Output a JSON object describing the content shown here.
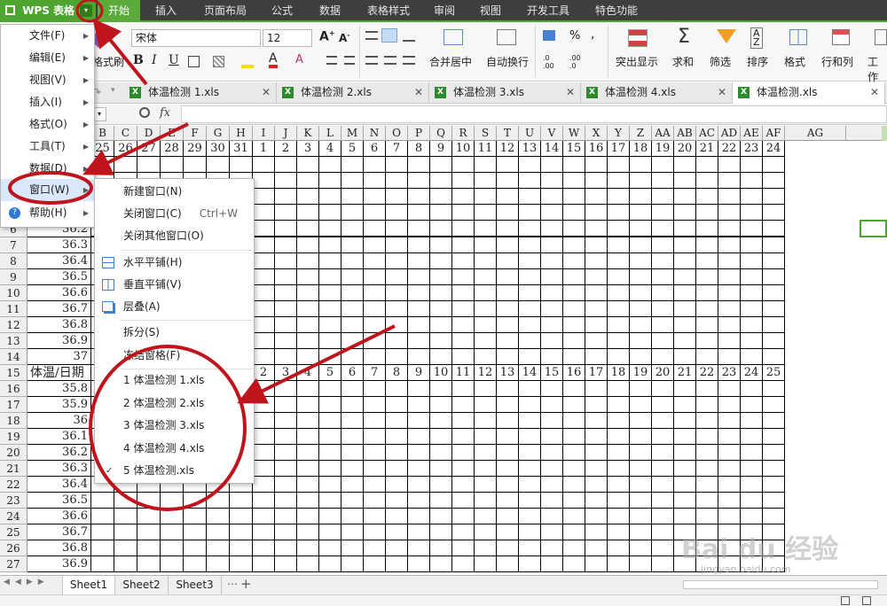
{
  "app": {
    "title": "WPS 表格",
    "dropdown_glyph": "▾"
  },
  "tabs": [
    "开始",
    "插入",
    "页面布局",
    "公式",
    "数据",
    "表格样式",
    "审阅",
    "视图",
    "开发工具",
    "特色功能"
  ],
  "ribbon": {
    "font_name": "宋体",
    "font_size": "12",
    "format_painter": "格式刷",
    "bold": "B",
    "italic": "I",
    "underline": "U",
    "merge_center": "合并居中",
    "wrap_text": "自动换行",
    "percent": "%",
    "comma": ",",
    "conditional": "突出显示",
    "sum": "求和",
    "filter": "筛选",
    "sort": "排序",
    "format": "格式",
    "rows_cols": "行和列",
    "worksheet": "工作"
  },
  "doc_tabs": [
    "体温检测 1.xls",
    "体温检测 2.xls",
    "体温检测 3.xls",
    "体温检测 4.xls",
    "体温检测.xls"
  ],
  "formula_bar": {
    "fx": "fx"
  },
  "columns": [
    "B",
    "C",
    "D",
    "E",
    "F",
    "G",
    "H",
    "I",
    "J",
    "K",
    "L",
    "M",
    "N",
    "O",
    "P",
    "Q",
    "R",
    "S",
    "T",
    "U",
    "V",
    "W",
    "X",
    "Y",
    "Z",
    "AA",
    "AB",
    "AC",
    "AD",
    "AE",
    "AF",
    "AG"
  ],
  "header_row_days": [
    "25",
    "26",
    "27",
    "28",
    "29",
    "30",
    "31",
    "1",
    "2",
    "3",
    "4",
    "5",
    "6",
    "7",
    "8",
    "9",
    "10",
    "11",
    "12",
    "13",
    "14",
    "15",
    "16",
    "17",
    "18",
    "19",
    "20",
    "21",
    "22",
    "23",
    "24"
  ],
  "row15_days": [
    "1",
    "2",
    "3",
    "4",
    "5",
    "6",
    "7",
    "8",
    "9",
    "10",
    "11",
    "12",
    "13",
    "14",
    "15",
    "16",
    "17",
    "18",
    "19",
    "20",
    "21",
    "22",
    "23",
    "24",
    "25"
  ],
  "rows": [
    {
      "n": "6",
      "a": "36.2"
    },
    {
      "n": "7",
      "a": "36.3"
    },
    {
      "n": "8",
      "a": "36.4"
    },
    {
      "n": "9",
      "a": "36.5"
    },
    {
      "n": "10",
      "a": "36.6"
    },
    {
      "n": "11",
      "a": "36.7"
    },
    {
      "n": "12",
      "a": "36.8"
    },
    {
      "n": "13",
      "a": "36.9"
    },
    {
      "n": "14",
      "a": "37"
    },
    {
      "n": "15",
      "a": "体温/日期"
    },
    {
      "n": "16",
      "a": "35.8"
    },
    {
      "n": "17",
      "a": "35.9"
    },
    {
      "n": "18",
      "a": "36"
    },
    {
      "n": "19",
      "a": "36.1"
    },
    {
      "n": "20",
      "a": "36.2"
    },
    {
      "n": "21",
      "a": "36.3"
    },
    {
      "n": "22",
      "a": "36.4"
    },
    {
      "n": "23",
      "a": "36.5"
    },
    {
      "n": "24",
      "a": "36.6"
    },
    {
      "n": "25",
      "a": "36.7"
    },
    {
      "n": "26",
      "a": "36.8"
    },
    {
      "n": "27",
      "a": "36.9"
    }
  ],
  "main_menu": [
    "文件(F)",
    "编辑(E)",
    "视图(V)",
    "插入(I)",
    "格式(O)",
    "工具(T)",
    "数据(D)",
    "窗口(W)",
    "帮助(H)"
  ],
  "window_menu": {
    "new_window": "新建窗口(N)",
    "close_window": "关闭窗口(C)",
    "close_window_shortcut": "Ctrl+W",
    "close_others": "关闭其他窗口(O)",
    "tile_horizontal": "水平平铺(H)",
    "tile_vertical": "垂直平铺(V)",
    "cascade": "层叠(A)",
    "split": "拆分(S)",
    "freeze": "冻结窗格(F)",
    "files": [
      "1 体温检测 1.xls",
      "2 体温检测 2.xls",
      "3 体温检测 3.xls",
      "4 体温检测 4.xls",
      "5 体温检测.xls"
    ]
  },
  "sheets": [
    "Sheet1",
    "Sheet2",
    "Sheet3"
  ],
  "watermark": "Bai du 经验",
  "watermark_url": "jingyan.baidu.com",
  "colors": {
    "accent": "#4ea42f",
    "annotation": "#c0141c",
    "menubar": "#3e3e3e"
  }
}
